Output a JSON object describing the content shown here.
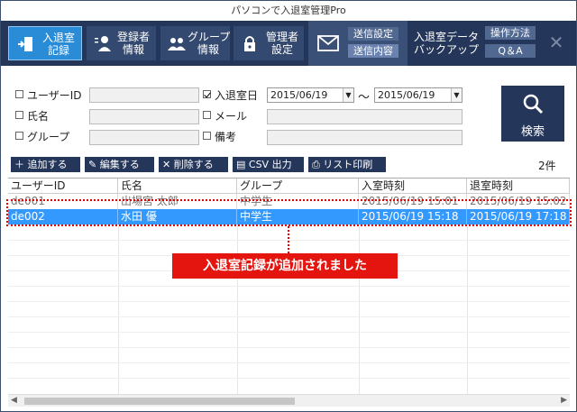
{
  "window": {
    "title": "パソコンで入退室管理Pro"
  },
  "toolbar": {
    "room_label": "入退室\n記録",
    "register_label": "登録者\n情報",
    "group_label": "グループ\n情報",
    "admin_label": "管理者\n設定",
    "send_settings": "送信設定",
    "send_content": "送信内容",
    "backup_label": "入退室データ\nバックアップ",
    "help_label": "操作方法",
    "qa_label": "Q＆A",
    "close_label": "✕"
  },
  "search": {
    "user_id_label": "ユーザーID",
    "name_label": "氏名",
    "group_label": "グループ",
    "date_label": "入退室日",
    "date_checked": true,
    "date_from": "2015/06/19",
    "date_to": "2015/06/19",
    "tilde": "〜",
    "mail_label": "メール",
    "note_label": "備考",
    "search_button": "検索"
  },
  "actions": {
    "add": "追加する",
    "edit": "編集する",
    "delete": "削除する",
    "csv": "CSV 出力",
    "print": "リスト印刷",
    "count": "2件"
  },
  "table": {
    "headers": [
      "ユーザーID",
      "氏名",
      "グループ",
      "入室時刻",
      "退室時刻"
    ],
    "rows": [
      [
        "de001",
        "出場宮 太郎",
        "中学生",
        "2015/06/19 15:01",
        "2015/06/19 15:02"
      ],
      [
        "de002",
        "水田 優",
        "中学生",
        "2015/06/19 15:18",
        "2015/06/19 17:18"
      ]
    ]
  },
  "callout": {
    "text": "入退室記録が追加されました"
  },
  "colors": {
    "toolbar": "#24365a",
    "selected_row": "#3399ff",
    "callout": "#e4150f",
    "active_tab": "#2a8bd6"
  }
}
